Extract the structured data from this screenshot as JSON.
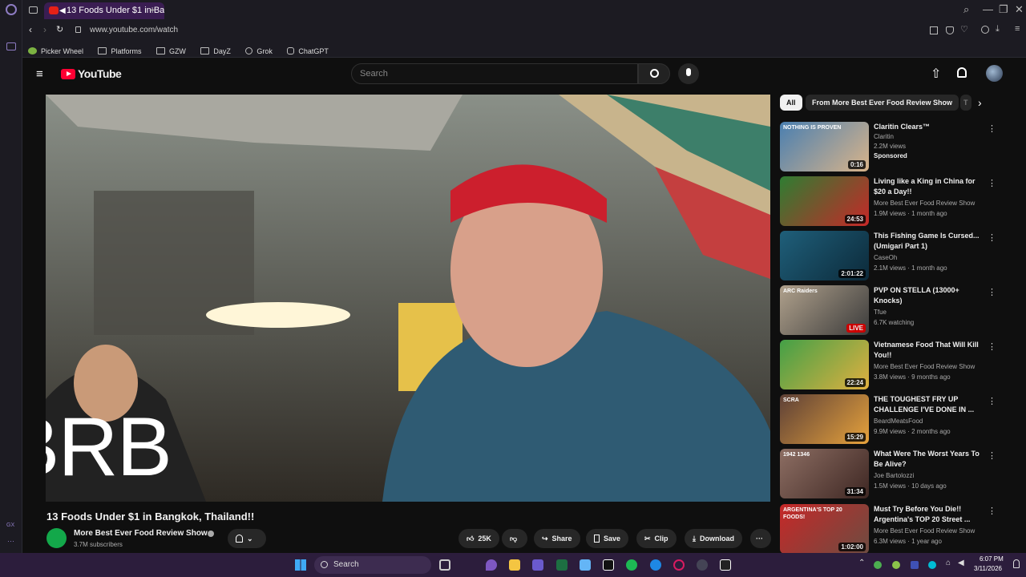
{
  "browser": {
    "tab_title": "13 Foods Under $1 in Ba",
    "new_tab": "+",
    "url": "www.youtube.com/watch",
    "bookmarks": [
      "Picker Wheel",
      "Platforms",
      "GZW",
      "DayZ",
      "Grok",
      "ChatGPT"
    ],
    "sidebar_label": "GX"
  },
  "youtube": {
    "logo": "YouTube",
    "search_placeholder": "Search",
    "overlay_text": "BRB",
    "video_title": "13 Foods Under $1 in Bangkok, Thailand!!",
    "channel_name": "More Best Ever Food Review Show",
    "subscribers": "3.7M subscribers",
    "likes": "25K",
    "share": "Share",
    "save": "Save",
    "clip": "Clip",
    "download": "Download",
    "chips": [
      "All",
      "From More Best Ever Food Review Show",
      "T"
    ],
    "recs": [
      {
        "title": "Claritin Clears™",
        "channel": "Claritin",
        "meta": "2.2M views",
        "extra": "Sponsored",
        "dur": "0:16",
        "thumb_text": "NOTHING IS PROVEN",
        "colors": [
          "#4a7fb0",
          "#d9b48a"
        ]
      },
      {
        "title": "Living like a King in China for $20 a Day!!",
        "channel": "More Best Ever Food Review Show",
        "meta": "1.9M views · 1 month ago",
        "dur": "24:53",
        "colors": [
          "#2e7d32",
          "#c62828"
        ]
      },
      {
        "title": "This Fishing Game Is Cursed... (Umigari Part 1)",
        "channel": "CaseOh",
        "meta": "2.1M views · 1 month ago",
        "dur": "2:01:22",
        "colors": [
          "#1f5f7a",
          "#0c2a3a"
        ]
      },
      {
        "title": "PVP ON STELLA (13000+ Knocks)",
        "channel": "Tfue",
        "meta": "6.7K watching",
        "live": "LIVE",
        "thumb_text": "ARC Raiders",
        "colors": [
          "#b0a18c",
          "#3b3b3b"
        ]
      },
      {
        "title": "Vietnamese Food That Will Kill You!!",
        "channel": "More Best Ever Food Review Show",
        "meta": "3.8M views · 9 months ago",
        "dur": "22:24",
        "colors": [
          "#43a047",
          "#e0b040"
        ]
      },
      {
        "title": "THE TOUGHEST FRY UP CHALLENGE I'VE DONE IN ...",
        "channel": "BeardMeatsFood",
        "meta": "9.9M views · 2 months ago",
        "dur": "15:29",
        "thumb_text": "SCRA",
        "colors": [
          "#5d4037",
          "#e6a23c"
        ]
      },
      {
        "title": "What Were The Worst Years To Be Alive?",
        "channel": "Joe Bartolozzi",
        "meta": "1.5M views · 10 days ago",
        "dur": "31:34",
        "thumb_text": "1942 1346",
        "colors": [
          "#8d6e63",
          "#3e2723"
        ]
      },
      {
        "title": "Must Try Before You Die!! Argentina's TOP 20 Street ...",
        "channel": "More Best Ever Food Review Show",
        "meta": "6.3M views · 1 year ago",
        "dur": "1:02:00",
        "thumb_text": "ARGENTINA'S TOP 20 FOODS!",
        "colors": [
          "#c62828",
          "#6d4c41"
        ]
      }
    ]
  },
  "taskbar": {
    "search": "Search",
    "time": "6:07 PM",
    "date": "3/11/2026"
  },
  "colors": {
    "accent": "#ff0033",
    "browser_bg": "#1c1b22",
    "taskbar_bg": "#2c1d3c"
  }
}
